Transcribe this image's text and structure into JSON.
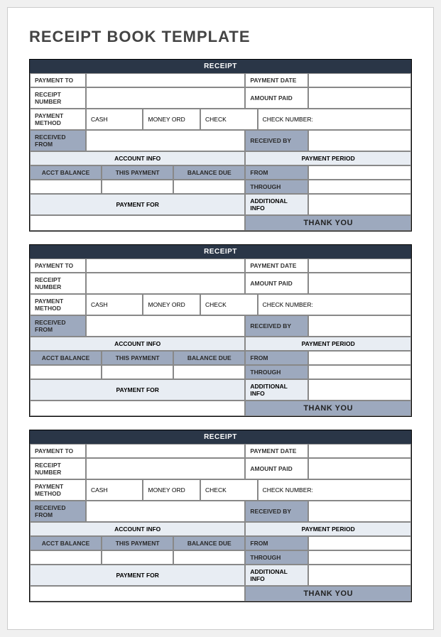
{
  "title": "RECEIPT BOOK TEMPLATE",
  "receipt": {
    "header": "RECEIPT",
    "labels": {
      "payment_to": "PAYMENT TO",
      "payment_date": "PAYMENT DATE",
      "receipt_number": "RECEIPT NUMBER",
      "amount_paid": "AMOUNT PAID",
      "payment_method": "PAYMENT METHOD",
      "cash": "CASH",
      "money_ord": "MONEY ORD",
      "check": "CHECK",
      "check_number": "CHECK NUMBER:",
      "received_from": "RECEIVED FROM",
      "received_by": "RECEIVED BY",
      "account_info": "ACCOUNT INFO",
      "payment_period": "PAYMENT PERIOD",
      "acct_balance": "ACCT BALANCE",
      "this_payment": "THIS PAYMENT",
      "balance_due": "BALANCE DUE",
      "from": "FROM",
      "through": "THROUGH",
      "payment_for": "PAYMENT FOR",
      "additional_info": "ADDITIONAL INFO",
      "thank_you": "THANK YOU"
    }
  }
}
